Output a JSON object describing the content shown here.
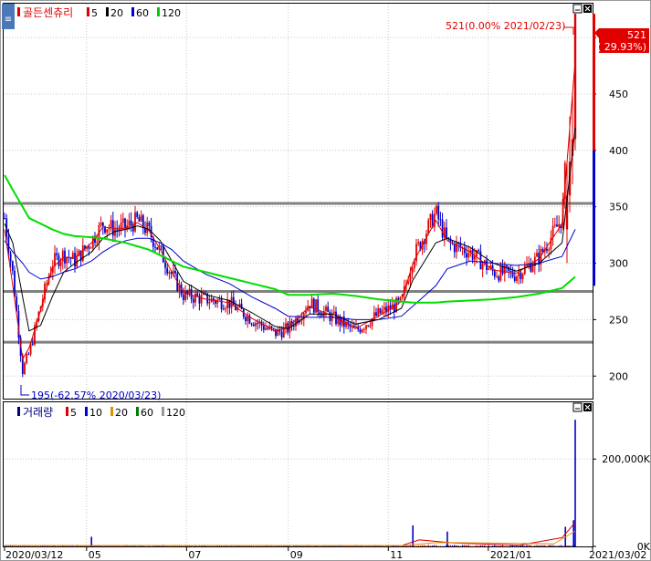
{
  "stock_name": "골든센츄리",
  "volume_label": "거래량",
  "price_legend": [
    {
      "label": "5",
      "color": "#e00000"
    },
    {
      "label": "20",
      "color": "#000000"
    },
    {
      "label": "60",
      "color": "#0000cc"
    },
    {
      "label": "120",
      "color": "#00cc00"
    }
  ],
  "volume_legend": [
    {
      "label": "5",
      "color": "#e00000"
    },
    {
      "label": "10",
      "color": "#0000cc"
    },
    {
      "label": "20",
      "color": "#e09000"
    },
    {
      "label": "60",
      "color": "#008000"
    },
    {
      "label": "120",
      "color": "#999999"
    }
  ],
  "high_annotation": "521(0.00% 2021/02/23)",
  "low_annotation": "195(-62.57% 2020/03/23)",
  "current_price": {
    "value": "521",
    "change": "( 29.93%)"
  },
  "colors": {
    "up": "#e00000",
    "down": "#0000cc",
    "ma120": "#00dd00",
    "hline": "#808080",
    "grid": "#c8c8c8"
  },
  "chart_data": [
    {
      "type": "candlestick",
      "title": "골든센츄리",
      "x_ticks": [
        "2020/03/12",
        "05",
        "07",
        "09",
        "11",
        "2021/01",
        "2021/03/02"
      ],
      "y_ticks": [
        200,
        250,
        300,
        350,
        400,
        450,
        500
      ],
      "ylim": [
        180,
        530
      ],
      "horizontal_lines": [
        353,
        275,
        230
      ],
      "high": {
        "value": 521,
        "date": "2021/02/23"
      },
      "low": {
        "value": 195,
        "date": "2020/03/23"
      },
      "close_series": [
        {
          "date": "2020/03/12",
          "value": 340
        },
        {
          "date": "2020/03/17",
          "value": 290
        },
        {
          "date": "2020/03/23",
          "value": 205
        },
        {
          "date": "2020/03/27",
          "value": 220
        },
        {
          "date": "2020/04/03",
          "value": 262
        },
        {
          "date": "2020/04/10",
          "value": 300
        },
        {
          "date": "2020/04/17",
          "value": 308
        },
        {
          "date": "2020/04/24",
          "value": 302
        },
        {
          "date": "2020/05/04",
          "value": 320
        },
        {
          "date": "2020/05/11",
          "value": 335
        },
        {
          "date": "2020/05/18",
          "value": 330
        },
        {
          "date": "2020/05/25",
          "value": 332
        },
        {
          "date": "2020/06/01",
          "value": 338
        },
        {
          "date": "2020/06/08",
          "value": 328
        },
        {
          "date": "2020/06/15",
          "value": 310
        },
        {
          "date": "2020/06/22",
          "value": 290
        },
        {
          "date": "2020/06/29",
          "value": 272
        },
        {
          "date": "2020/07/13",
          "value": 268
        },
        {
          "date": "2020/07/27",
          "value": 265
        },
        {
          "date": "2020/08/10",
          "value": 250
        },
        {
          "date": "2020/08/24",
          "value": 238
        },
        {
          "date": "2020/09/01",
          "value": 242
        },
        {
          "date": "2020/09/14",
          "value": 265
        },
        {
          "date": "2020/09/28",
          "value": 252
        },
        {
          "date": "2020/10/12",
          "value": 240
        },
        {
          "date": "2020/10/26",
          "value": 255
        },
        {
          "date": "2020/11/09",
          "value": 265
        },
        {
          "date": "2020/11/16",
          "value": 305
        },
        {
          "date": "2020/11/30",
          "value": 345
        },
        {
          "date": "2020/12/07",
          "value": 318
        },
        {
          "date": "2020/12/21",
          "value": 310
        },
        {
          "date": "2021/01/04",
          "value": 292
        },
        {
          "date": "2021/01/18",
          "value": 290
        },
        {
          "date": "2021/02/01",
          "value": 305
        },
        {
          "date": "2021/02/15",
          "value": 340
        },
        {
          "date": "2021/02/23",
          "value": 521
        }
      ],
      "ma_series": [
        {
          "name": "5",
          "values": [
            330,
            280,
            215,
            225,
            258,
            296,
            305,
            305,
            318,
            332,
            331,
            331,
            336,
            329,
            312,
            292,
            274,
            268,
            265,
            251,
            240,
            243,
            262,
            253,
            242,
            253,
            266,
            300,
            338,
            320,
            310,
            294,
            291,
            304,
            335,
            480
          ]
        },
        {
          "name": "20",
          "values": [
            335,
            318,
            270,
            240,
            245,
            270,
            292,
            300,
            310,
            322,
            328,
            330,
            333,
            330,
            320,
            302,
            284,
            272,
            267,
            256,
            244,
            242,
            255,
            255,
            246,
            250,
            260,
            285,
            318,
            322,
            314,
            300,
            293,
            300,
            318,
            420
          ]
        },
        {
          "name": "60",
          "values": [
            320,
            310,
            300,
            292,
            286,
            288,
            292,
            295,
            302,
            310,
            316,
            320,
            322,
            322,
            318,
            312,
            302,
            290,
            282,
            270,
            260,
            253,
            252,
            252,
            250,
            250,
            253,
            262,
            280,
            295,
            302,
            300,
            298,
            300,
            306,
            330
          ]
        },
        {
          "name": "120",
          "values": [
            378,
            365,
            350,
            340,
            335,
            330,
            326,
            324,
            323,
            322,
            320,
            318,
            315,
            312,
            307,
            302,
            297,
            292,
            287,
            282,
            277,
            272,
            272,
            273,
            271,
            268,
            266,
            265,
            265,
            266,
            267,
            268,
            270,
            273,
            278,
            288
          ]
        }
      ]
    },
    {
      "type": "bar",
      "title": "거래량",
      "y_ticks": [
        "0K",
        "200,000K"
      ],
      "ylim": [
        0,
        330000
      ],
      "spikes": [
        {
          "date": "2020/05/04",
          "value": 22000
        },
        {
          "date": "2020/11/16",
          "value": 48000
        },
        {
          "date": "2020/12/07",
          "value": 34000
        },
        {
          "date": "2021/02/17",
          "value": 45000
        },
        {
          "date": "2021/02/22",
          "value": 60000
        },
        {
          "date": "2021/02/23",
          "value": 290000
        }
      ]
    }
  ]
}
